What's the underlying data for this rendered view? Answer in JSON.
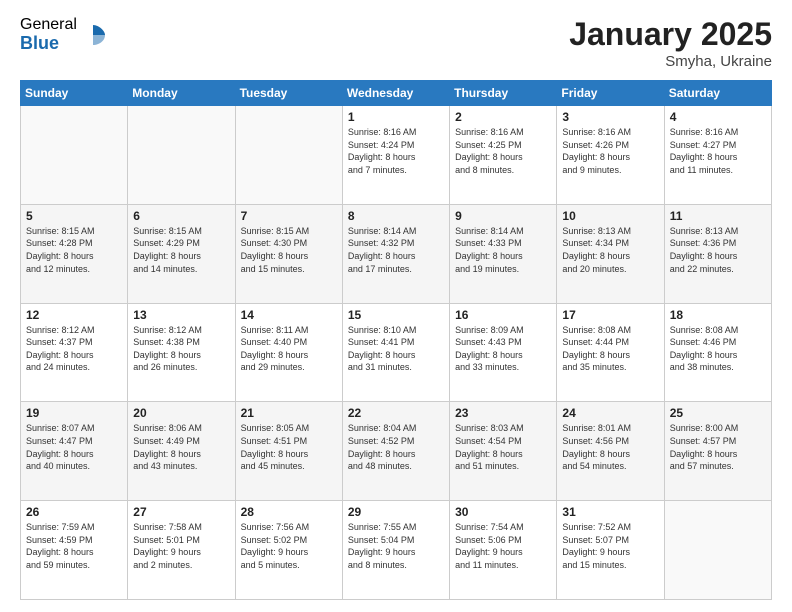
{
  "logo": {
    "general": "General",
    "blue": "Blue"
  },
  "header": {
    "month": "January 2025",
    "location": "Smyha, Ukraine"
  },
  "weekdays": [
    "Sunday",
    "Monday",
    "Tuesday",
    "Wednesday",
    "Thursday",
    "Friday",
    "Saturday"
  ],
  "weeks": [
    [
      {
        "day": "",
        "info": ""
      },
      {
        "day": "",
        "info": ""
      },
      {
        "day": "",
        "info": ""
      },
      {
        "day": "1",
        "info": "Sunrise: 8:16 AM\nSunset: 4:24 PM\nDaylight: 8 hours\nand 7 minutes."
      },
      {
        "day": "2",
        "info": "Sunrise: 8:16 AM\nSunset: 4:25 PM\nDaylight: 8 hours\nand 8 minutes."
      },
      {
        "day": "3",
        "info": "Sunrise: 8:16 AM\nSunset: 4:26 PM\nDaylight: 8 hours\nand 9 minutes."
      },
      {
        "day": "4",
        "info": "Sunrise: 8:16 AM\nSunset: 4:27 PM\nDaylight: 8 hours\nand 11 minutes."
      }
    ],
    [
      {
        "day": "5",
        "info": "Sunrise: 8:15 AM\nSunset: 4:28 PM\nDaylight: 8 hours\nand 12 minutes."
      },
      {
        "day": "6",
        "info": "Sunrise: 8:15 AM\nSunset: 4:29 PM\nDaylight: 8 hours\nand 14 minutes."
      },
      {
        "day": "7",
        "info": "Sunrise: 8:15 AM\nSunset: 4:30 PM\nDaylight: 8 hours\nand 15 minutes."
      },
      {
        "day": "8",
        "info": "Sunrise: 8:14 AM\nSunset: 4:32 PM\nDaylight: 8 hours\nand 17 minutes."
      },
      {
        "day": "9",
        "info": "Sunrise: 8:14 AM\nSunset: 4:33 PM\nDaylight: 8 hours\nand 19 minutes."
      },
      {
        "day": "10",
        "info": "Sunrise: 8:13 AM\nSunset: 4:34 PM\nDaylight: 8 hours\nand 20 minutes."
      },
      {
        "day": "11",
        "info": "Sunrise: 8:13 AM\nSunset: 4:36 PM\nDaylight: 8 hours\nand 22 minutes."
      }
    ],
    [
      {
        "day": "12",
        "info": "Sunrise: 8:12 AM\nSunset: 4:37 PM\nDaylight: 8 hours\nand 24 minutes."
      },
      {
        "day": "13",
        "info": "Sunrise: 8:12 AM\nSunset: 4:38 PM\nDaylight: 8 hours\nand 26 minutes."
      },
      {
        "day": "14",
        "info": "Sunrise: 8:11 AM\nSunset: 4:40 PM\nDaylight: 8 hours\nand 29 minutes."
      },
      {
        "day": "15",
        "info": "Sunrise: 8:10 AM\nSunset: 4:41 PM\nDaylight: 8 hours\nand 31 minutes."
      },
      {
        "day": "16",
        "info": "Sunrise: 8:09 AM\nSunset: 4:43 PM\nDaylight: 8 hours\nand 33 minutes."
      },
      {
        "day": "17",
        "info": "Sunrise: 8:08 AM\nSunset: 4:44 PM\nDaylight: 8 hours\nand 35 minutes."
      },
      {
        "day": "18",
        "info": "Sunrise: 8:08 AM\nSunset: 4:46 PM\nDaylight: 8 hours\nand 38 minutes."
      }
    ],
    [
      {
        "day": "19",
        "info": "Sunrise: 8:07 AM\nSunset: 4:47 PM\nDaylight: 8 hours\nand 40 minutes."
      },
      {
        "day": "20",
        "info": "Sunrise: 8:06 AM\nSunset: 4:49 PM\nDaylight: 8 hours\nand 43 minutes."
      },
      {
        "day": "21",
        "info": "Sunrise: 8:05 AM\nSunset: 4:51 PM\nDaylight: 8 hours\nand 45 minutes."
      },
      {
        "day": "22",
        "info": "Sunrise: 8:04 AM\nSunset: 4:52 PM\nDaylight: 8 hours\nand 48 minutes."
      },
      {
        "day": "23",
        "info": "Sunrise: 8:03 AM\nSunset: 4:54 PM\nDaylight: 8 hours\nand 51 minutes."
      },
      {
        "day": "24",
        "info": "Sunrise: 8:01 AM\nSunset: 4:56 PM\nDaylight: 8 hours\nand 54 minutes."
      },
      {
        "day": "25",
        "info": "Sunrise: 8:00 AM\nSunset: 4:57 PM\nDaylight: 8 hours\nand 57 minutes."
      }
    ],
    [
      {
        "day": "26",
        "info": "Sunrise: 7:59 AM\nSunset: 4:59 PM\nDaylight: 8 hours\nand 59 minutes."
      },
      {
        "day": "27",
        "info": "Sunrise: 7:58 AM\nSunset: 5:01 PM\nDaylight: 9 hours\nand 2 minutes."
      },
      {
        "day": "28",
        "info": "Sunrise: 7:56 AM\nSunset: 5:02 PM\nDaylight: 9 hours\nand 5 minutes."
      },
      {
        "day": "29",
        "info": "Sunrise: 7:55 AM\nSunset: 5:04 PM\nDaylight: 9 hours\nand 8 minutes."
      },
      {
        "day": "30",
        "info": "Sunrise: 7:54 AM\nSunset: 5:06 PM\nDaylight: 9 hours\nand 11 minutes."
      },
      {
        "day": "31",
        "info": "Sunrise: 7:52 AM\nSunset: 5:07 PM\nDaylight: 9 hours\nand 15 minutes."
      },
      {
        "day": "",
        "info": ""
      }
    ]
  ]
}
